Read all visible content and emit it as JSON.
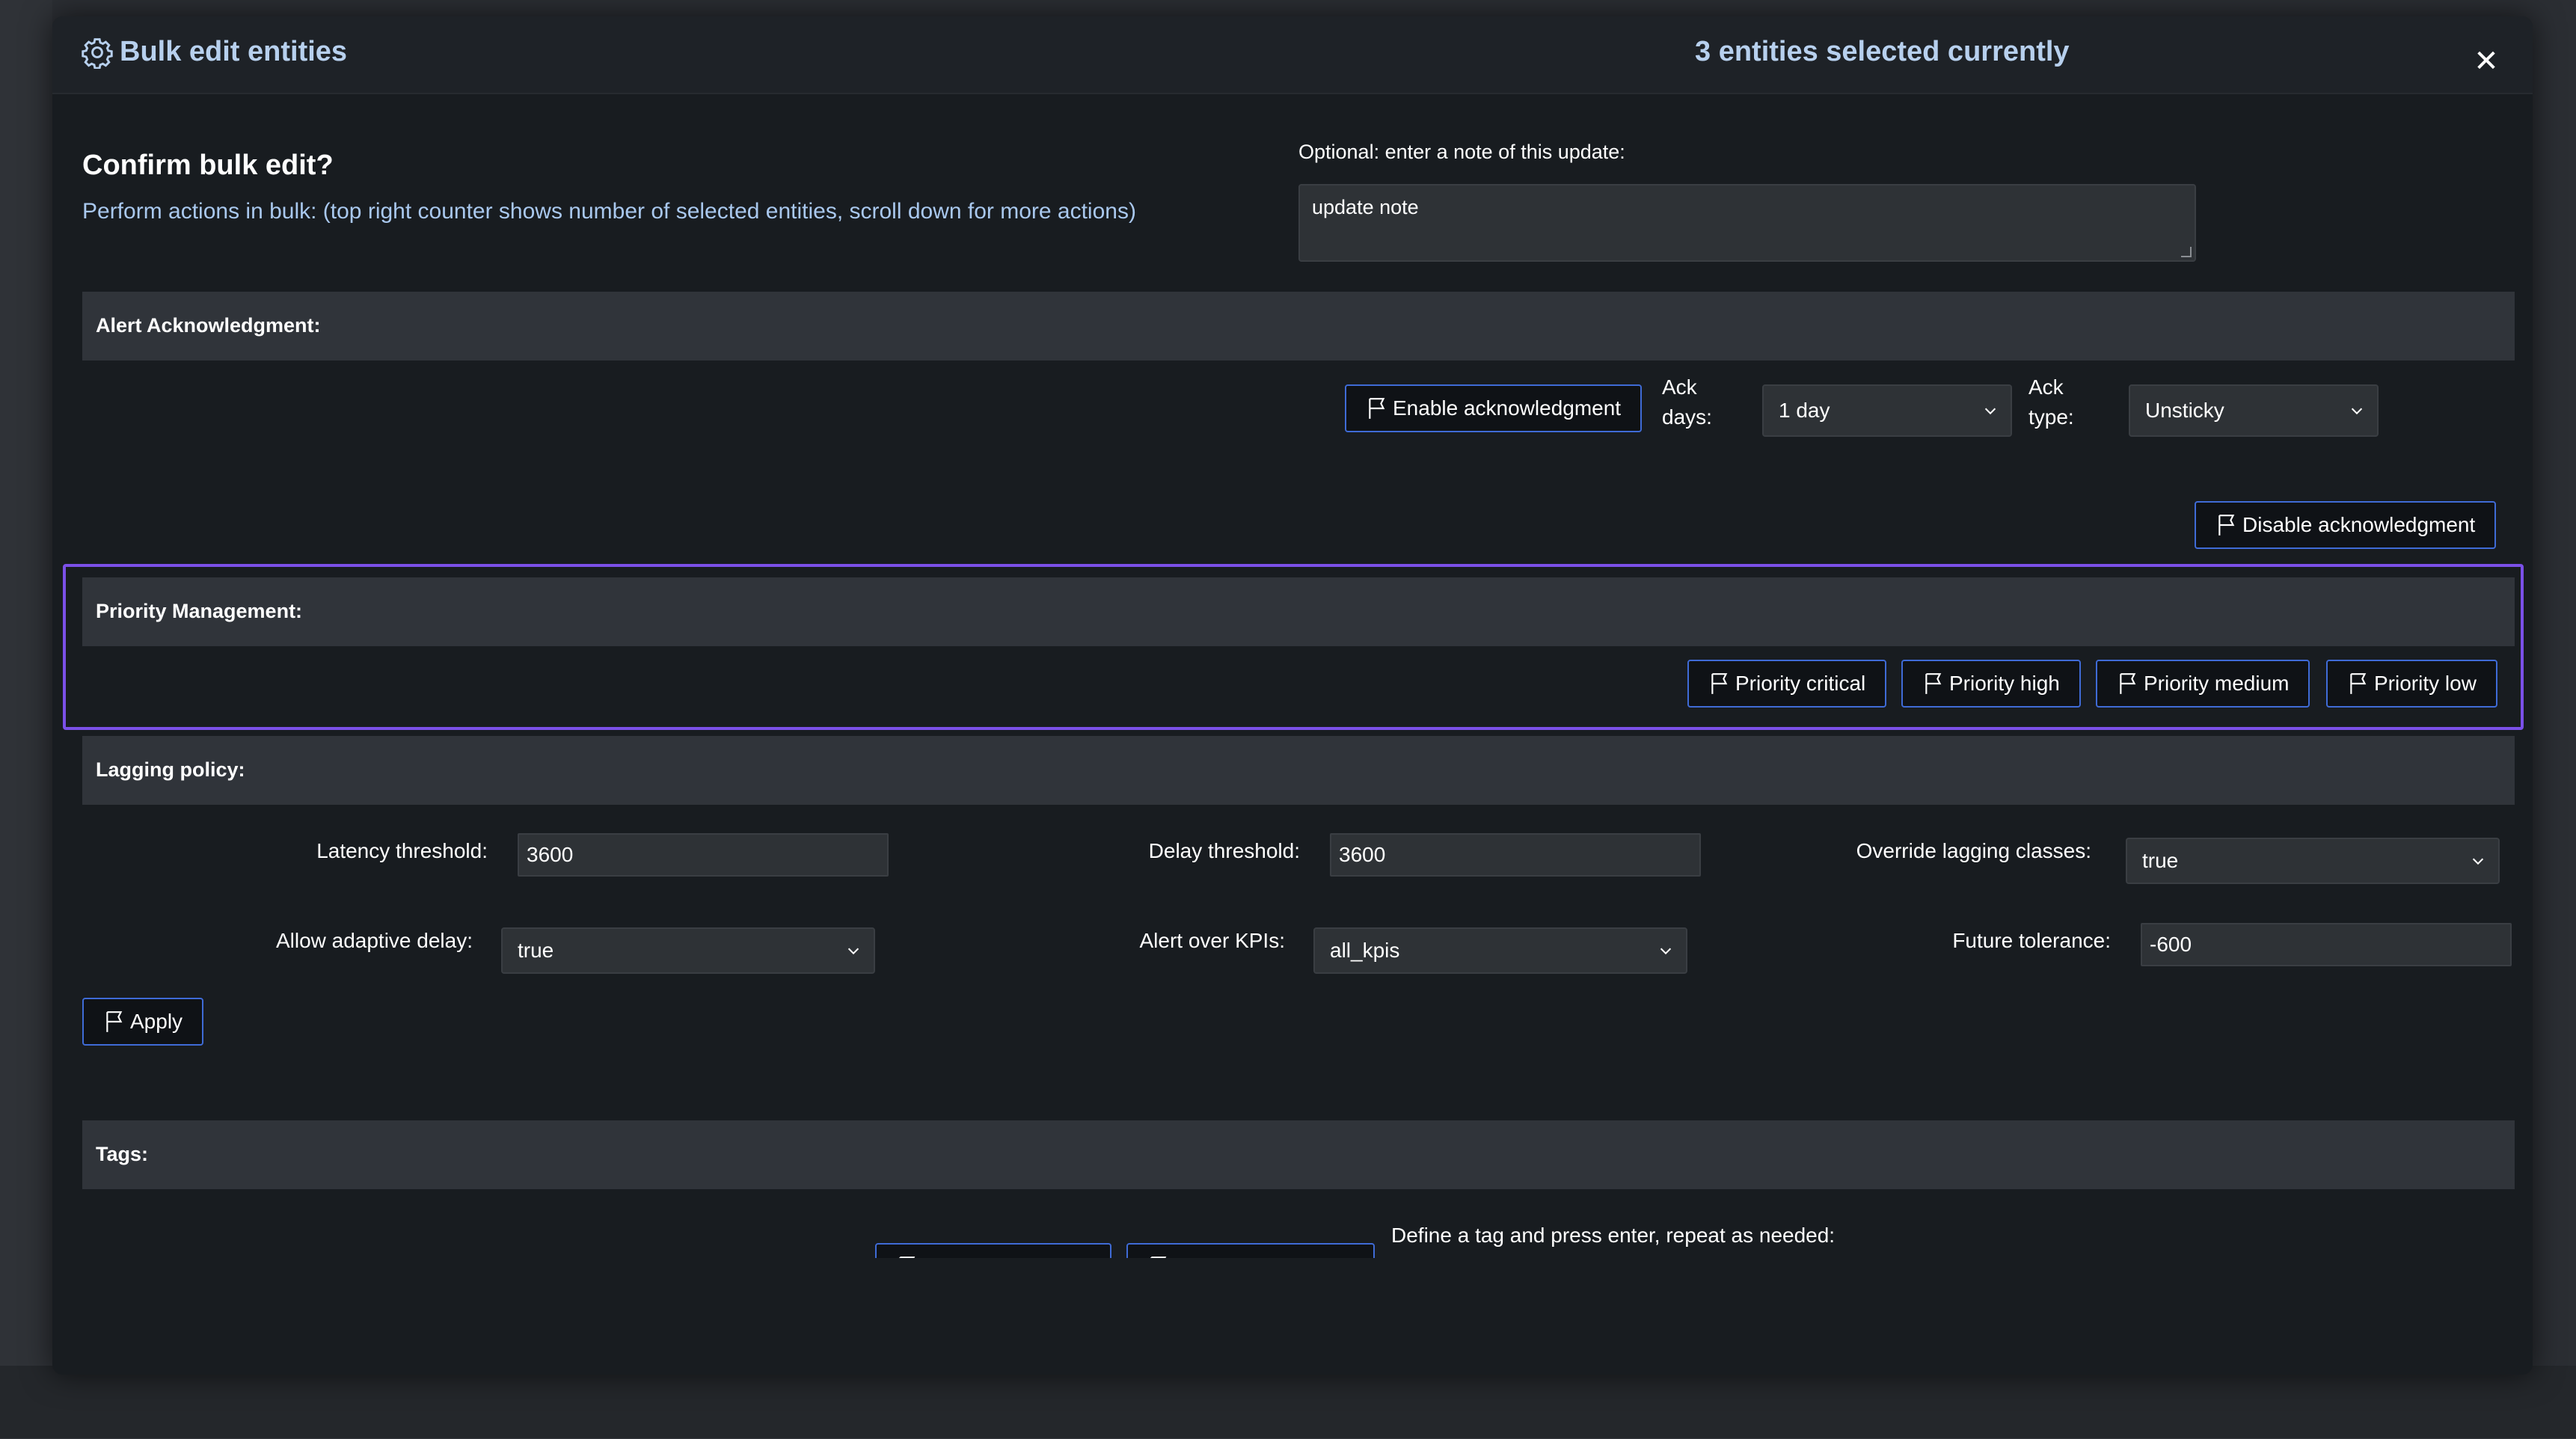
{
  "header": {
    "title": "Bulk edit entities",
    "counter": "3 entities selected currently",
    "close": "✕"
  },
  "confirm": {
    "title": "Confirm bulk edit?",
    "subtitle": "Perform actions in bulk: (top right counter shows number of selected entities, scroll down for more actions)"
  },
  "note": {
    "label": "Optional: enter a note of this update:",
    "value": "update note"
  },
  "ack": {
    "section_title": "Alert Acknowledgment:",
    "enable_label": "Enable acknowledgment",
    "ack_days_label": "Ack\ndays:",
    "ack_days_value": "1 day",
    "ack_type_label": "Ack\ntype:",
    "ack_type_value": "Unsticky",
    "disable_label": "Disable acknowledgment"
  },
  "priority": {
    "section_title": "Priority Management:",
    "buttons": [
      "Priority critical",
      "Priority high",
      "Priority medium",
      "Priority low"
    ]
  },
  "lagging": {
    "section_title": "Lagging policy:",
    "latency_label": "Latency threshold:",
    "latency_value": "3600",
    "delay_label": "Delay threshold:",
    "delay_value": "3600",
    "override_label": "Override lagging classes:",
    "override_value": "true",
    "adaptive_label": "Allow adaptive delay:",
    "adaptive_value": "true",
    "kpis_label": "Alert over KPIs:",
    "kpis_value": "all_kpis",
    "future_label": "Future tolerance:",
    "future_value": "-600",
    "apply_label": "Apply"
  },
  "tags": {
    "section_title": "Tags:",
    "hint": "Define a tag and press enter, repeat as needed:"
  },
  "colors": {
    "accent_border": "#3f6bd6",
    "highlight": "#7b50e8",
    "header_text": "#b7d0ee"
  }
}
